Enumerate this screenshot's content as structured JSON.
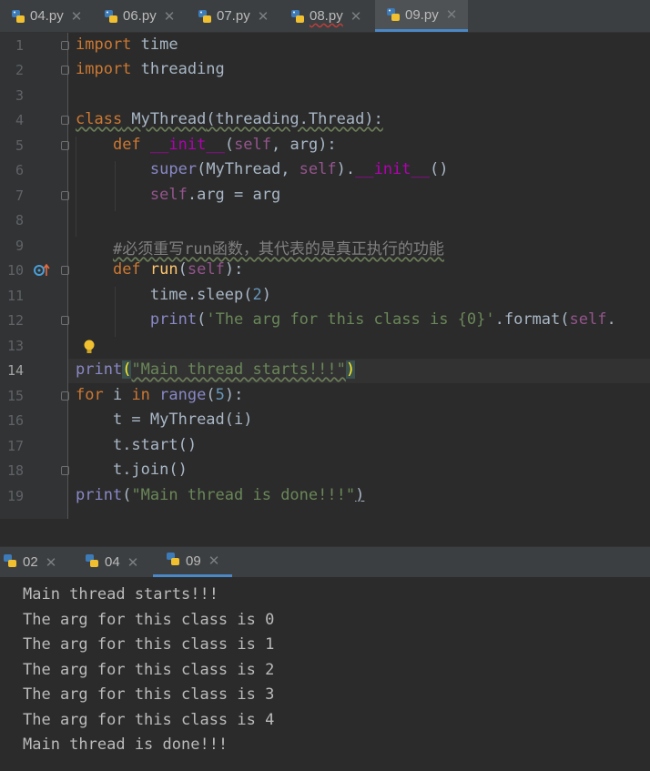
{
  "editor_tabs": [
    {
      "label": "04.py",
      "active": false,
      "error": false
    },
    {
      "label": "06.py",
      "active": false,
      "error": false
    },
    {
      "label": "07.py",
      "active": false,
      "error": false
    },
    {
      "label": "08.py",
      "active": false,
      "error": true
    },
    {
      "label": "09.py",
      "active": true,
      "error": false
    }
  ],
  "line_numbers": [
    "1",
    "2",
    "3",
    "4",
    "5",
    "6",
    "7",
    "8",
    "9",
    "10",
    "11",
    "12",
    "13",
    "14",
    "15",
    "16",
    "17",
    "18",
    "19"
  ],
  "code": {
    "l1": {
      "kw": "import",
      "rest": " time"
    },
    "l2": {
      "kw": "import",
      "rest": " threading"
    },
    "l4": {
      "kw": "class",
      "name": " MyThread",
      "rest": "(threading.Thread):"
    },
    "l5": {
      "indent": "    ",
      "kw": "def",
      "name": "__init__",
      "open": "(",
      "self": "self",
      "rest": ", arg):"
    },
    "l6": {
      "indent": "        ",
      "bi": "super",
      "a": "(MyThread, ",
      "self": "self",
      "b": ").",
      "dunder": "__init__",
      "c": "()"
    },
    "l7": {
      "indent": "        ",
      "self": "self",
      "rest": ".arg = arg"
    },
    "l9": {
      "indent": "    ",
      "comment": "#必须重写run函数，其代表的是真正执行的功能"
    },
    "l10": {
      "indent": "    ",
      "kw": "def",
      "name": " run",
      "open": "(",
      "self": "self",
      "rest": "):"
    },
    "l11": {
      "indent": "        ",
      "a": "time.sleep(",
      "num": "2",
      "b": ")"
    },
    "l12": {
      "indent": "        ",
      "bi": "print",
      "a": "(",
      "str": "'The arg for this class is {0}'",
      "b": ".format(",
      "self": "self",
      "c": "."
    },
    "l14": {
      "bi": "print",
      "open": "(",
      "str": "\"Main thread starts!!!\"",
      "close": ")"
    },
    "l15": {
      "kw": "for",
      "a": " i ",
      "kw2": "in",
      "bi": " range",
      "b": "(",
      "num": "5",
      "c": "):"
    },
    "l16": {
      "indent": "    ",
      "rest": "t = MyThread(i)"
    },
    "l17": {
      "indent": "    ",
      "rest": "t.start()"
    },
    "l18": {
      "indent": "    ",
      "rest": "t.join()"
    },
    "l19": {
      "bi": "print",
      "open": "(",
      "str": "\"Main thread is done!!!\"",
      "close": ")"
    }
  },
  "run_tabs": [
    {
      "label": "02",
      "active": false
    },
    {
      "label": "04",
      "active": false
    },
    {
      "label": "09",
      "active": true
    }
  ],
  "console_output": [
    "Main thread starts!!!",
    "The arg for this class is 0",
    "The arg for this class is 1",
    "The arg for this class is 2",
    "The arg for this class is 3",
    "The arg for this class is 4",
    "Main thread is done!!!"
  ],
  "colors": {
    "keyword": "#cc7832",
    "function": "#ffc66d",
    "string": "#6a8759",
    "number": "#6897bb",
    "self": "#94558d",
    "accent": "#4a88c7"
  },
  "icons": {
    "file": "python-file-icon",
    "override": "override-method-icon",
    "hint": "lightbulb-icon"
  }
}
